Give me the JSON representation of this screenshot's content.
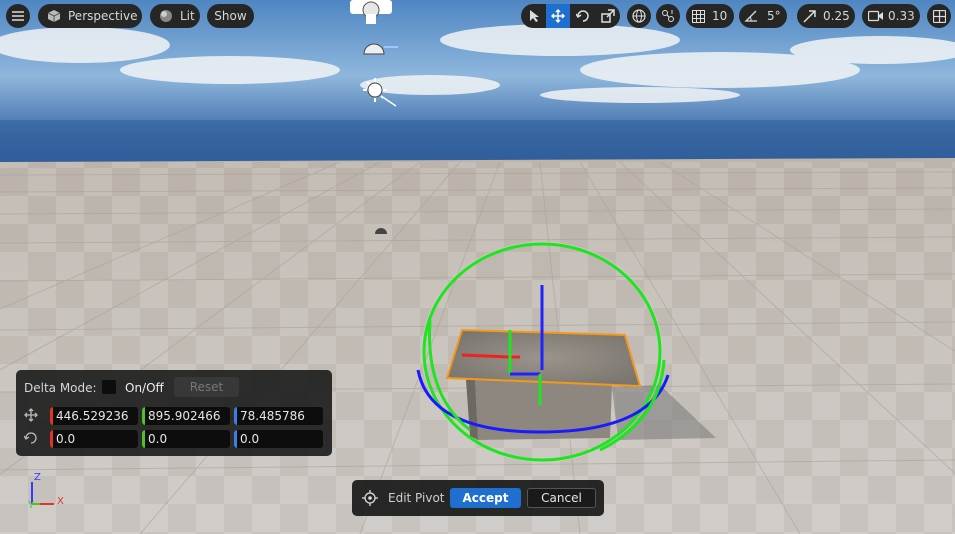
{
  "toolbar": {
    "menu_icon": "hamburger-menu-icon",
    "perspective_label": "Perspective",
    "lit_label": "Lit",
    "show_label": "Show",
    "grid_snap_value": "10",
    "rotation_snap_value": "5°",
    "scale_snap_value": "0.25",
    "camera_speed_value": "0.33"
  },
  "delta_panel": {
    "delta_mode_label": "Delta Mode:",
    "toggle_label": "On/Off",
    "reset_label": "Reset",
    "location": {
      "x": "446.529236",
      "y": "895.902466",
      "z": "78.485786"
    },
    "rotation": {
      "x": "0.0",
      "y": "0.0",
      "z": "0.0"
    }
  },
  "axis_indicator": {
    "z": "Z",
    "y": "Y",
    "x": "X"
  },
  "pivot_bar": {
    "label": "Edit Pivot",
    "accept_label": "Accept",
    "cancel_label": "Cancel"
  },
  "colors": {
    "accent": "#1f6fd1",
    "x_axis": "#e0342a",
    "y_axis": "#4fbf2a",
    "z_axis": "#3a7fe8"
  }
}
